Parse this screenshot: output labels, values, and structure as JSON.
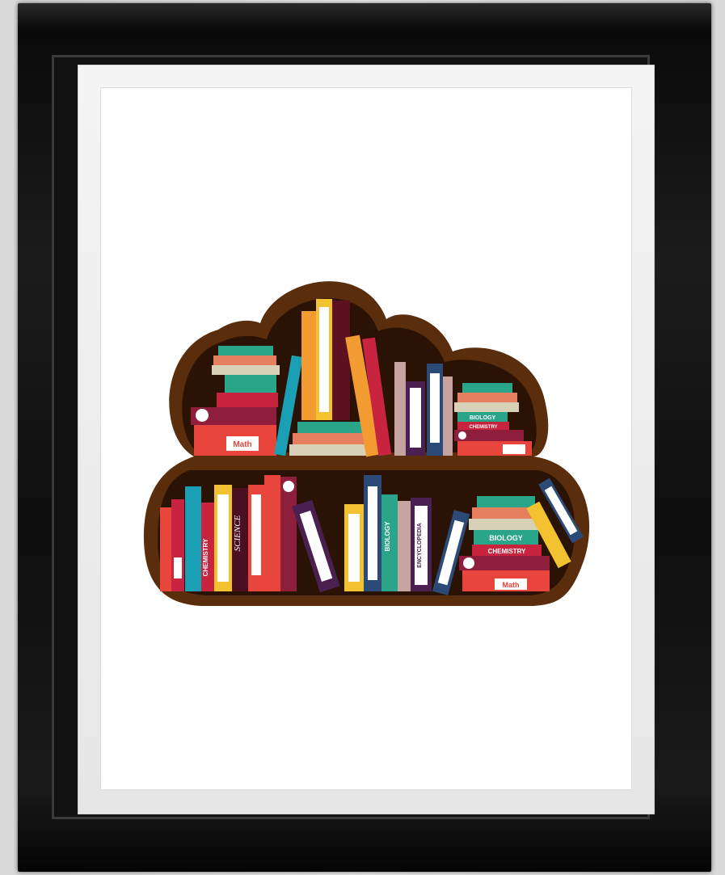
{
  "artwork": {
    "subject": "cloud-shaped-bookshelf",
    "frame_color": "#111111",
    "mat_color": "#eeeeee",
    "shelf_color": "#5a2d0c",
    "shelf_interior": "#2a1204"
  },
  "book_labels": {
    "math_top": "Math",
    "chemistry_top": "CHEMISTRY",
    "biology_top": "BIOLOGY",
    "chemistry_bottom": "CHEMISTRY",
    "science_bottom": "SCIENCE",
    "biology_bottom": "BIOLOGY",
    "encyclopedia": "ENCYCLOPEDIA",
    "biology_stack": "BIOLOGY",
    "chemistry_stack": "CHEMISTRY",
    "math_bottom": "Math"
  }
}
